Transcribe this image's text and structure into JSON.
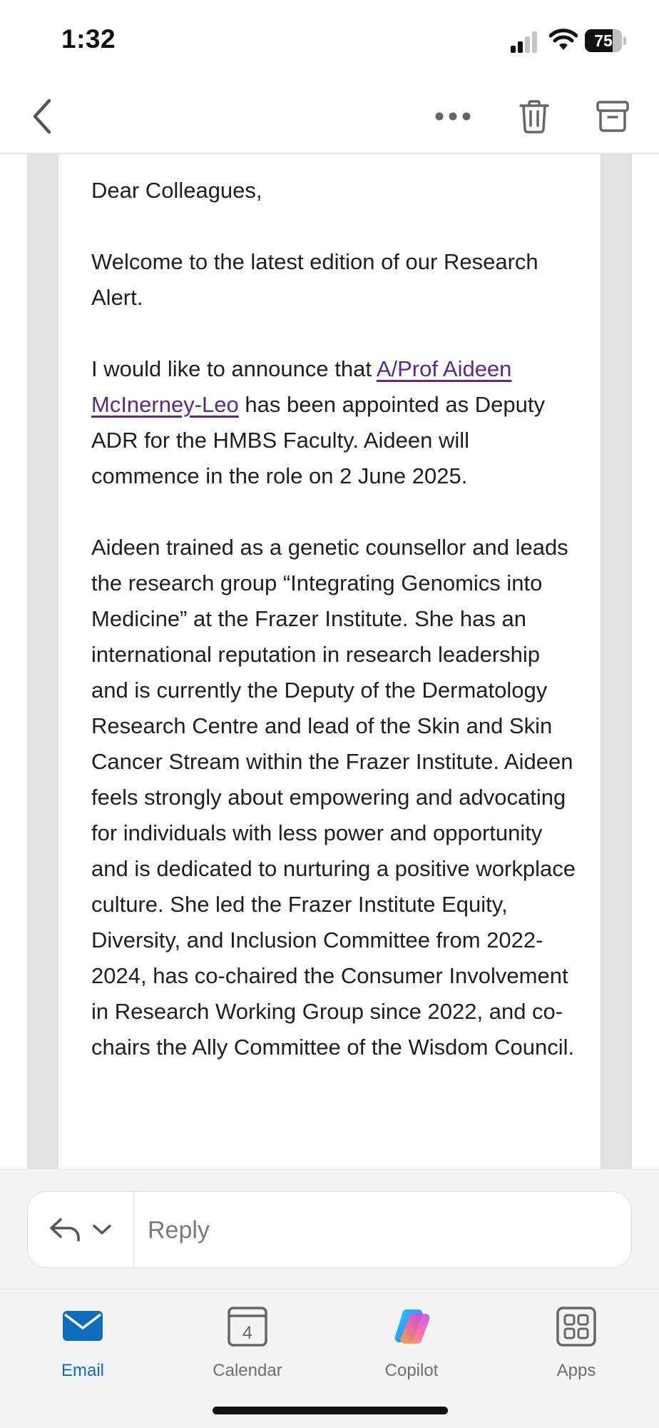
{
  "status_bar": {
    "time": "1:32",
    "battery_level": 75
  },
  "toolbar": {
    "back_icon": "chevron-left-icon",
    "more_icon": "more-horizontal-icon",
    "delete_icon": "trash-icon",
    "archive_icon": "archive-icon"
  },
  "email": {
    "greeting": "Dear Colleagues,",
    "intro": "Welcome to the latest edition of our Research Alert.",
    "announcement": {
      "before_link": "I would like to announce that ",
      "link_text": "A/Prof Aideen McInerney-Leo",
      "after_link": " has been appointed as Deputy ADR for the HMBS Faculty. Aideen will commence in the role on 2 June 2025."
    },
    "bio": "Aideen trained as a genetic counsellor and leads the research group “Integrating Genomics into Medicine” at the Frazer Institute. She has an international reputation in research leadership and is currently the Deputy of the Dermatology Research Centre and lead of the Skin and Skin Cancer Stream within the Frazer Institute. Aideen feels strongly about empowering and advocating for individuals with less power and opportunity and is dedicated to nurturing a positive workplace culture. She led the Frazer Institute Equity, Diversity, and Inclusion Committee from 2022-2024, has co-chaired the Consumer Involvement in Research Working Group since 2022, and co-chairs the Ally Committee of the Wisdom Council."
  },
  "reply": {
    "placeholder": "Reply",
    "icon": "reply-icon",
    "dropdown_icon": "chevron-down-icon"
  },
  "tabs": [
    {
      "label": "Email",
      "icon": "mail-icon",
      "active": true
    },
    {
      "label": "Calendar",
      "icon": "calendar-icon",
      "badge": "4"
    },
    {
      "label": "Copilot",
      "icon": "copilot-icon"
    },
    {
      "label": "Apps",
      "icon": "apps-grid-icon"
    }
  ],
  "colors": {
    "accent": "#0f6cbd",
    "link": "#5b2a86",
    "frame": "#e1e1e1"
  }
}
